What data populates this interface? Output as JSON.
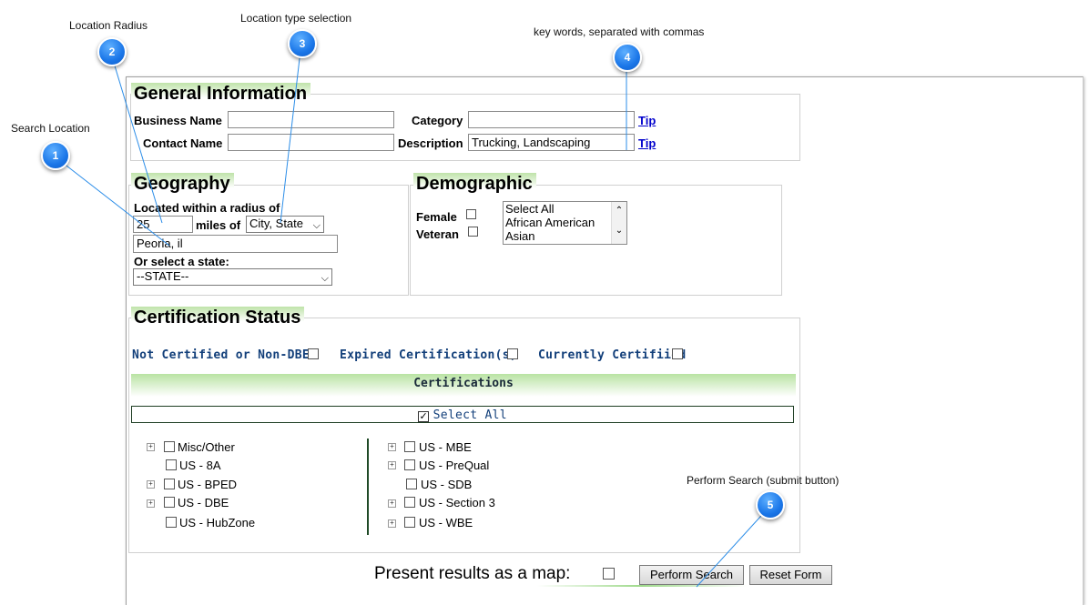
{
  "annotations": [
    {
      "number": "1",
      "label": "Search Location"
    },
    {
      "number": "2",
      "label": "Location Radius"
    },
    {
      "number": "3",
      "label": "Location type selection"
    },
    {
      "number": "4",
      "label": "key words, separated with commas"
    },
    {
      "number": "5",
      "label": "Perform Search (submit button)"
    }
  ],
  "general": {
    "title": "General Information",
    "business_name_label": "Business Name",
    "business_name_value": "",
    "contact_name_label": "Contact Name",
    "contact_name_value": "",
    "category_label": "Category",
    "category_value": "",
    "description_label": "Description",
    "description_value": "Trucking, Landscaping",
    "tip_label": "Tip"
  },
  "geography": {
    "title": "Geography",
    "radius_label": "Located within a radius of",
    "radius_value": "25",
    "miles_of_label": "miles of",
    "location_type_selected": "City, State",
    "location_value": "Peoria, il",
    "state_label": "Or select a state:",
    "state_selected": "--STATE--"
  },
  "demographic": {
    "title": "Demographic",
    "female_label": "Female",
    "veteran_label": "Veteran",
    "list_options": [
      "Select All",
      "African American",
      "Asian"
    ]
  },
  "certification": {
    "title": "Certification Status",
    "not_certified_label": "Not Certified or Non-DBE",
    "expired_label": "Expired Certification(s)",
    "currently_label": "Currently Certifiied",
    "certifications_header": "Certifications",
    "select_all_label": "Select All",
    "select_all_checked": true,
    "left_items": [
      "Misc/Other",
      "US - 8A",
      "US - BPED",
      "US - DBE",
      "US - HubZone"
    ],
    "right_items": [
      "US - MBE",
      "US - PreQual",
      "US - SDB",
      "US - Section 3",
      "US - WBE"
    ]
  },
  "footer": {
    "map_label": "Present results as a map:",
    "perform_search_label": "Perform Search",
    "reset_label": "Reset Form"
  }
}
